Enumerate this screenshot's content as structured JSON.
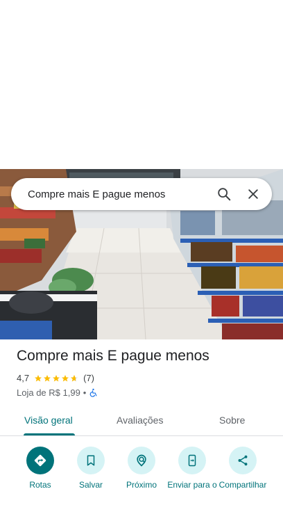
{
  "search": {
    "query": "Compre mais E pague menos"
  },
  "place": {
    "name": "Compre mais E pague menos",
    "rating": "4,7",
    "rating_value": 4.7,
    "review_count": "(7)",
    "category": "Loja de R$ 1,99",
    "separator": "•"
  },
  "tabs": [
    {
      "label": "Visão geral",
      "active": true
    },
    {
      "label": "Avaliações",
      "active": false
    },
    {
      "label": "Sobre",
      "active": false
    }
  ],
  "actions": [
    {
      "label": "Rotas",
      "icon": "directions-icon"
    },
    {
      "label": "Salvar",
      "icon": "bookmark-icon"
    },
    {
      "label": "Próximo",
      "icon": "nearby-icon"
    },
    {
      "label": "Enviar para o",
      "icon": "send-to-phone-icon"
    },
    {
      "label": "Compartilhar",
      "icon": "share-icon"
    }
  ],
  "colors": {
    "accent": "#00737a",
    "accent_light": "#d5f3f5",
    "star": "#fbbc04",
    "accessible": "#1a73e8"
  }
}
